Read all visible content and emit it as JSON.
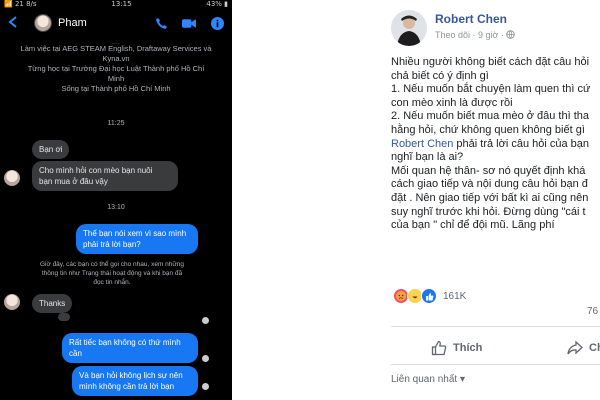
{
  "phone": {
    "status_left": "📶 21 8/s",
    "status_time": "13:15",
    "status_right": "43% ▮",
    "contact_name": "Pham",
    "info_lines": [
      "Làm việc tại AEG STEAM English, Draftaway Services và",
      "Kyna.vn",
      "Từng học tại Trường Đại học Luật Thành phố Hồ Chí",
      "Minh",
      "Sống tại Thành phố Hồ Chí Minh"
    ],
    "time_1": "11:25",
    "msg_1": "Bạn ơi",
    "msg_2a": "Cho mình hỏi con mèo bạn nuôi",
    "msg_2b": "bạn mua ở đâu vậy",
    "time_2": "13:10",
    "msg_3a": "Thế bạn nói xem vì sao mình",
    "msg_3b": "phải trả lời bạn?",
    "notice_lines": [
      "Giờ đây, các bạn có thể gọi cho nhau, xem những",
      "thông tin như Trạng thái hoạt động và khi bạn đã",
      "đọc tin nhắn."
    ],
    "msg_4": "Thanks",
    "msg_5a": "Rất tiếc bạn không có thứ mình",
    "msg_5b": "cần",
    "msg_6a": "Và bạn hỏi không lịch sự nên",
    "msg_6b": "mình không cần trả lời bạn"
  },
  "post": {
    "author": "Robert Chen",
    "meta_follow": "Theo dõi",
    "meta_time": "· 9 giờ ·",
    "body": [
      {
        "t": "Nhiều người không biết cách đặt câu hỏi"
      },
      {
        "t": "chả biết có ý định gì"
      },
      {
        "t": "1. Nếu muốn bắt chuyện làm quen thì cứ"
      },
      {
        "t": "con mèo xinh là được rồi"
      },
      {
        "t": "2. Nếu muốn biết mua mèo ở đâu thì tha"
      },
      {
        "t": "hằng hỏi, chứ không quen không biết gì"
      },
      {
        "link": "Robert Chen",
        "t": " phải trả lời câu hỏi của bạn"
      },
      {
        "t": "nghĩ bạn là ai?"
      },
      {
        "t": "Mối quan hệ thân- sơ nó quyết định khá"
      },
      {
        "t": "cách giao tiếp và nội dung câu hỏi bạn đ"
      },
      {
        "t": "đặt . Nên giao tiếp với bất kì ai cũng nên"
      },
      {
        "t": "suy nghĩ trước khi hỏi. Đừng dùng \"cái t"
      },
      {
        "t": "của bạn \" chỉ để đội mũ. Lãng phí"
      }
    ],
    "reaction_count": "161K",
    "comment_count": "76",
    "like_label": "Thích",
    "share_label": "Chia",
    "related_label": "Liên quan nhất ▾"
  }
}
